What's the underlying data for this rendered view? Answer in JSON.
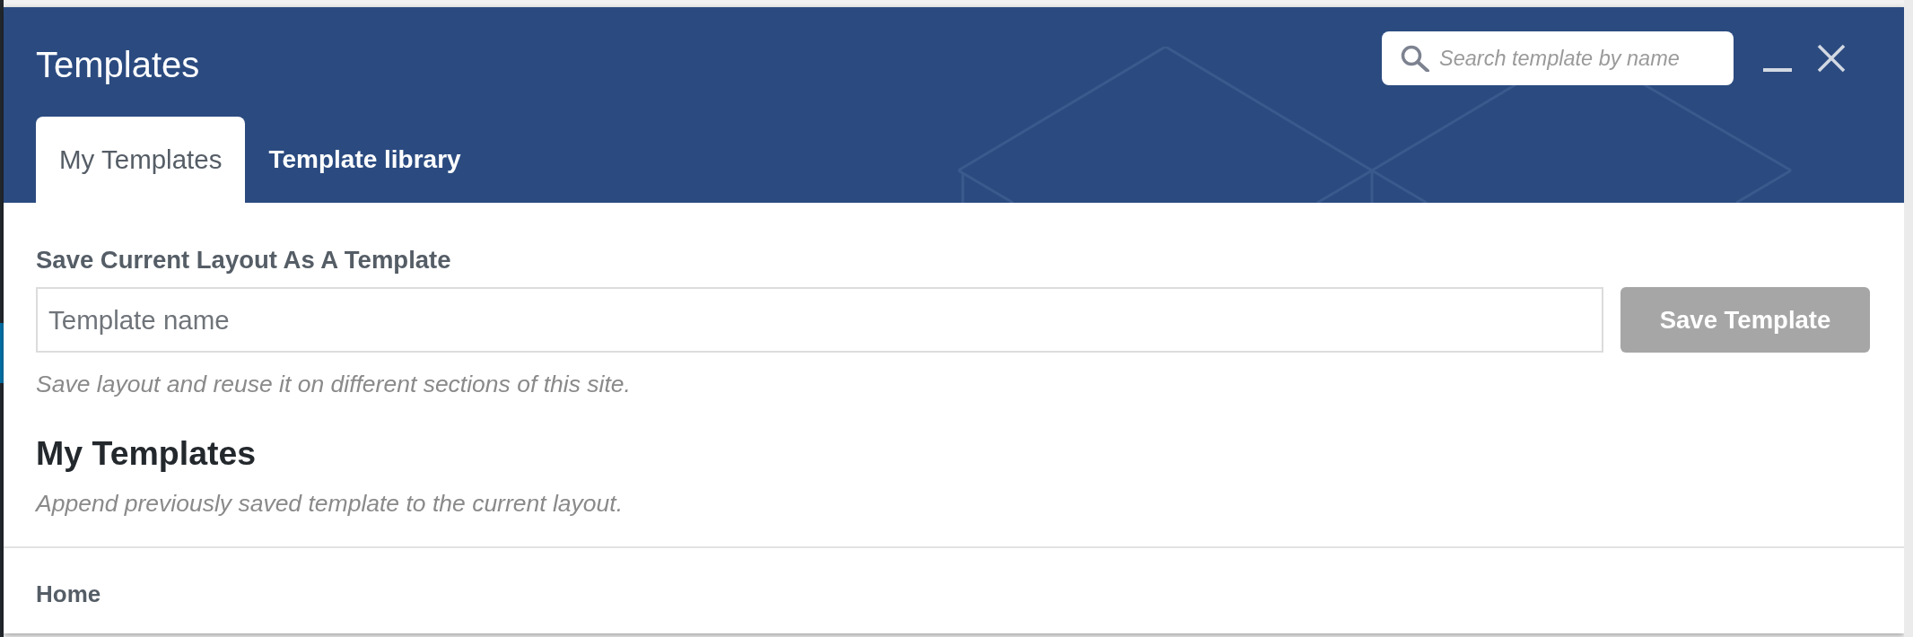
{
  "dialog": {
    "title": "Templates",
    "search": {
      "placeholder": "Search template by name"
    }
  },
  "tabs": [
    {
      "label": "My Templates",
      "selected": true
    },
    {
      "label": "Template library",
      "selected": false
    }
  ],
  "save_section": {
    "heading": "Save Current Layout As A Template",
    "name_field": {
      "placeholder": "Template name"
    },
    "save_button": {
      "label": "Save Template",
      "disabled": true
    },
    "help": "Save layout and reuse it on different sections of this site."
  },
  "templates_section": {
    "heading": "My Templates",
    "description": "Append previously saved template to the current layout.",
    "items": [
      {
        "label": "Home"
      }
    ]
  }
}
